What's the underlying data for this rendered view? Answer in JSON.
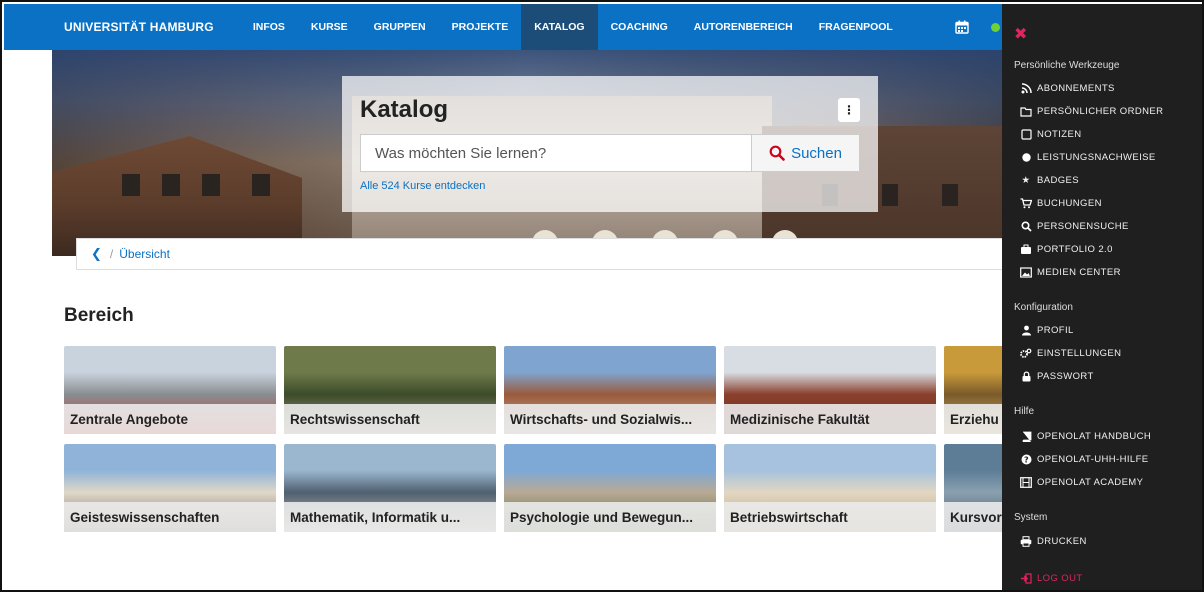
{
  "header": {
    "brand": "UNIVERSITÄT HAMBURG",
    "nav": [
      {
        "label": "INFOS",
        "active": false
      },
      {
        "label": "KURSE",
        "active": false
      },
      {
        "label": "GRUPPEN",
        "active": false
      },
      {
        "label": "PROJEKTE",
        "active": false
      },
      {
        "label": "KATALOG",
        "active": true
      },
      {
        "label": "COACHING",
        "active": false
      },
      {
        "label": "AUTORENBEREICH",
        "active": false
      },
      {
        "label": "FRAGENPOOL",
        "active": false
      }
    ],
    "calendar_icon": "calendar-icon",
    "status_color": "#6fd13a"
  },
  "search": {
    "title": "Katalog",
    "placeholder": "Was möchten Sie lernen?",
    "button_label": "Suchen",
    "all_courses_link": "Alle 524 Kurse entdecken"
  },
  "breadcrumb": {
    "current": "Übersicht"
  },
  "section": {
    "heading": "Bereich",
    "tiles": [
      {
        "label": "Zentrale Angebote",
        "colors": [
          "#c9d3de",
          "#8a8d90",
          "#c8322c"
        ]
      },
      {
        "label": "Rechtswissenschaft",
        "colors": [
          "#6f7a4a",
          "#3c4b2a",
          "#b3a48a"
        ]
      },
      {
        "label": "Wirtschafts- und Sozialwis...",
        "colors": [
          "#7fa4cf",
          "#9a5a3b",
          "#c9b9a3"
        ]
      },
      {
        "label": "Medizinische Fakultät",
        "colors": [
          "#d8dde3",
          "#8a3f2c",
          "#6a3222"
        ]
      },
      {
        "label": "Erziehu",
        "colors": [
          "#c99a3a",
          "#7a5a2a",
          "#d9b86a"
        ]
      },
      {
        "label": "Geisteswissenschaften",
        "colors": [
          "#8fb3d9",
          "#e0d8c8",
          "#6f6a62"
        ]
      },
      {
        "label": "Mathematik, Informatik u...",
        "colors": [
          "#9ab7cf",
          "#506070",
          "#c9c4b8"
        ]
      },
      {
        "label": "Psychologie und Bewegun...",
        "colors": [
          "#7ea9d6",
          "#b9a995",
          "#4e6a3a"
        ]
      },
      {
        "label": "Betriebswirtschaft",
        "colors": [
          "#a6c2de",
          "#e2d7c2",
          "#b9a27c"
        ]
      },
      {
        "label": "Kursvor",
        "colors": [
          "#5d7d96",
          "#8aa0b0",
          "#3d4f5c"
        ]
      }
    ]
  },
  "panel": {
    "groups": [
      {
        "title": "Persönliche Werkzeuge",
        "items": [
          {
            "label": "ABONNEMENTS",
            "icon": "rss-icon"
          },
          {
            "label": "PERSÖNLICHER ORDNER",
            "icon": "folder-icon"
          },
          {
            "label": "NOTIZEN",
            "icon": "note-icon"
          },
          {
            "label": "LEISTUNGSNACHWEISE",
            "icon": "certificate-icon"
          },
          {
            "label": "BADGES",
            "icon": "star-icon"
          },
          {
            "label": "BUCHUNGEN",
            "icon": "cart-icon"
          },
          {
            "label": "PERSONENSUCHE",
            "icon": "search-icon"
          },
          {
            "label": "PORTFOLIO 2.0",
            "icon": "briefcase-icon"
          },
          {
            "label": "MEDIEN CENTER",
            "icon": "image-icon"
          }
        ]
      },
      {
        "title": "Konfiguration",
        "items": [
          {
            "label": "PROFIL",
            "icon": "user-icon"
          },
          {
            "label": "EINSTELLUNGEN",
            "icon": "gears-icon"
          },
          {
            "label": "PASSWORT",
            "icon": "lock-icon"
          }
        ]
      },
      {
        "title": "Hilfe",
        "items": [
          {
            "label": "OPENOLAT HANDBUCH",
            "icon": "book-icon"
          },
          {
            "label": "OPENOLAT-UHH-HILFE",
            "icon": "question-icon"
          },
          {
            "label": "OPENOLAT ACADEMY",
            "icon": "film-icon"
          }
        ]
      },
      {
        "title": "System",
        "items": [
          {
            "label": "DRUCKEN",
            "icon": "print-icon"
          }
        ]
      }
    ],
    "logout_label": "LOG OUT",
    "accent": "#e0245e"
  }
}
